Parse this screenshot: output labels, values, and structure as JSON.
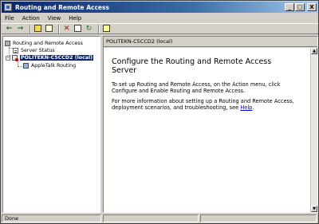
{
  "window": {
    "title": "Routing and Remote Access",
    "caption_buttons": [
      "_",
      "□",
      "X"
    ]
  },
  "menu": [
    "File",
    "Action",
    "View",
    "Help"
  ],
  "toolbar": {
    "icons": [
      "back-icon",
      "forward-icon",
      "up-folder-icon",
      "show-tree-icon",
      "delete-icon",
      "properties-icon",
      "refresh-icon",
      "help-icon"
    ]
  },
  "tree": {
    "root_label": "Routing and Remote Access",
    "server_status_label": "Server Status",
    "server_label": "POLITEKN-C5CCD2 (local)",
    "appletalk_label": "AppleTalk Routing"
  },
  "right_pane": {
    "header": "POLITEKN-C5CCD2 (local)",
    "heading": "Configure the Routing and Remote Access Server",
    "para1": "To set up Routing and Remote Access, on the Action menu, click Configure and Enable Routing and Remote Access.",
    "para2_prefix": "For more information about setting up a Routing and Remote Access, deployment scenarios, and troubleshooting, see ",
    "para2_link": "Help",
    "para2_suffix": "."
  },
  "statusbar": {
    "text": "Done"
  },
  "colors": {
    "titlebar_start": "#0a246a",
    "titlebar_end": "#a6caf0",
    "selection": "#0a246a",
    "link": "#0000cc",
    "chrome": "#d4d0c8"
  }
}
